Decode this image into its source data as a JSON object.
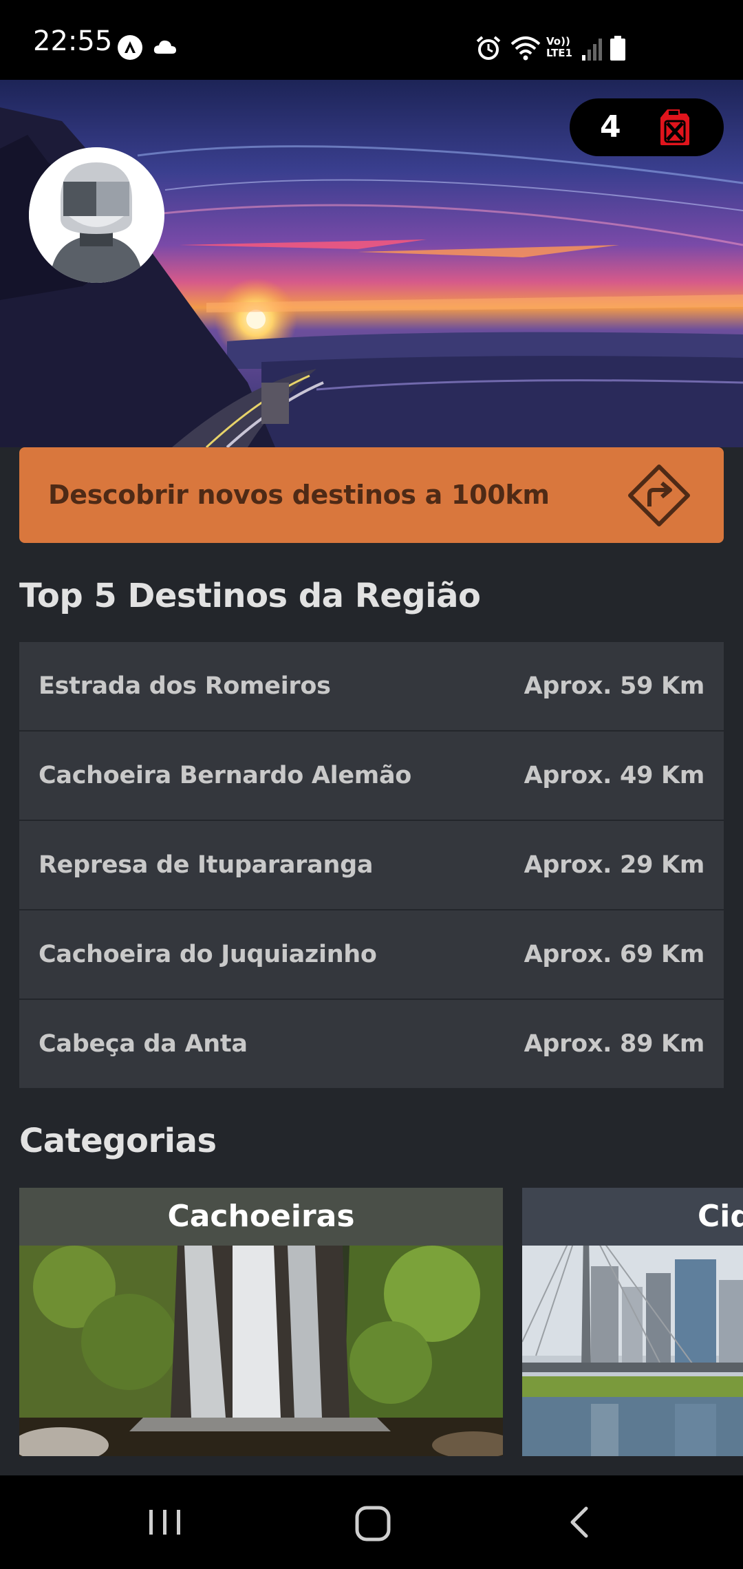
{
  "status_bar": {
    "time": "22:55",
    "left_icons": [
      "app-notification-icon",
      "cloud-icon"
    ],
    "right_icons": [
      "alarm-icon",
      "wifi-icon",
      "volte-lte-icon",
      "signal-icon",
      "battery-icon"
    ],
    "network_label_top": "Vo))",
    "network_label_bottom": "LTE1"
  },
  "hero": {
    "fuel_count": "4",
    "fuel_icon": "fuel-can-icon",
    "fuel_icon_color": "#e0141c"
  },
  "cta": {
    "label": "Descobrir novos destinos a 100km",
    "icon": "route-sign-icon",
    "background": "#d9773d"
  },
  "top_destinations": {
    "title": "Top 5 Destinos da Região",
    "items": [
      {
        "name": "Estrada dos Romeiros",
        "distance": "Aprox. 59 Km"
      },
      {
        "name": "Cachoeira Bernardo Alemão",
        "distance": "Aprox. 49 Km"
      },
      {
        "name": "Represa de Itupararanga",
        "distance": "Aprox. 29 Km"
      },
      {
        "name": "Cachoeira do Juquiazinho",
        "distance": "Aprox. 69 Km"
      },
      {
        "name": "Cabeça da Anta",
        "distance": "Aprox. 89 Km"
      }
    ]
  },
  "categories": {
    "title": "Categorias",
    "items": [
      {
        "label": "Cachoeiras"
      },
      {
        "label": "Cidades"
      }
    ]
  },
  "nav_bar": {
    "buttons": [
      "recent-apps-icon",
      "home-icon",
      "back-icon"
    ]
  }
}
